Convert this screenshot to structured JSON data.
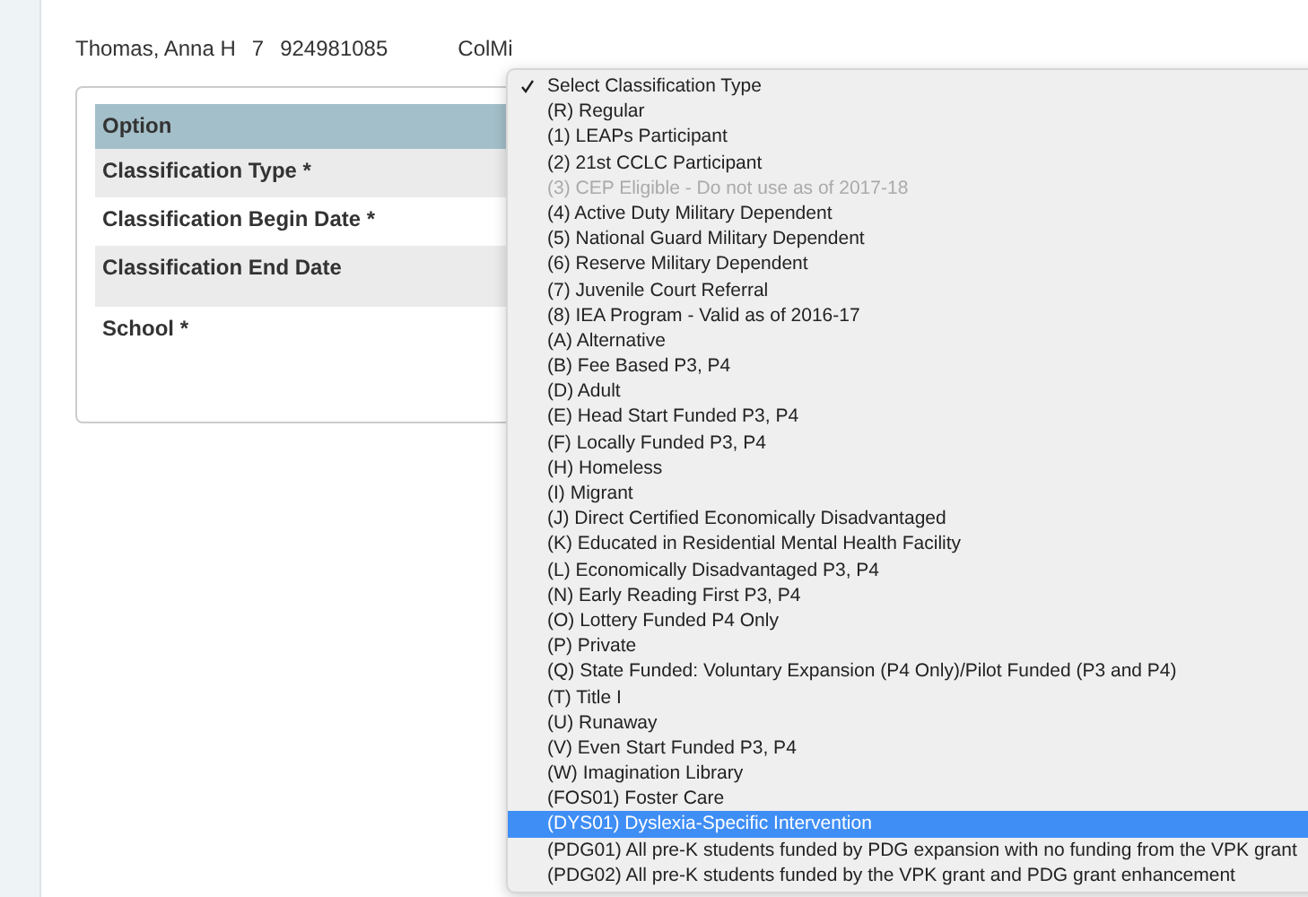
{
  "student_header": {
    "name": "Thomas, Anna H",
    "grade": "7",
    "id": "924981085",
    "school_code": "ColMi"
  },
  "options_table": {
    "header": "Option",
    "rows": [
      {
        "label": "Classification Type *"
      },
      {
        "label": "Classification Begin Date *"
      },
      {
        "label": "Classification End Date"
      },
      {
        "label": "School *"
      }
    ]
  },
  "classification_menu": {
    "items": [
      {
        "label": "Select Classification Type",
        "checked": true,
        "disabled": false,
        "selected": false
      },
      {
        "label": "(R) Regular",
        "checked": false,
        "disabled": false,
        "selected": false
      },
      {
        "label": "(1) LEAPs Participant",
        "checked": false,
        "disabled": false,
        "selected": false
      },
      {
        "label": "(2) 21st CCLC Participant",
        "checked": false,
        "disabled": false,
        "selected": false
      },
      {
        "label": "(3) CEP Eligible - Do not use as of 2017-18",
        "checked": false,
        "disabled": true,
        "selected": false
      },
      {
        "label": "(4) Active Duty Military Dependent",
        "checked": false,
        "disabled": false,
        "selected": false
      },
      {
        "label": "(5) National Guard Military Dependent",
        "checked": false,
        "disabled": false,
        "selected": false
      },
      {
        "label": "(6) Reserve Military Dependent",
        "checked": false,
        "disabled": false,
        "selected": false
      },
      {
        "label": "(7) Juvenile Court Referral",
        "checked": false,
        "disabled": false,
        "selected": false
      },
      {
        "label": "(8) IEA Program - Valid as of 2016-17",
        "checked": false,
        "disabled": false,
        "selected": false
      },
      {
        "label": "(A) Alternative",
        "checked": false,
        "disabled": false,
        "selected": false
      },
      {
        "label": "(B) Fee Based P3, P4",
        "checked": false,
        "disabled": false,
        "selected": false
      },
      {
        "label": "(D) Adult",
        "checked": false,
        "disabled": false,
        "selected": false
      },
      {
        "label": "(E) Head Start Funded P3, P4",
        "checked": false,
        "disabled": false,
        "selected": false
      },
      {
        "label": "(F) Locally Funded P3, P4",
        "checked": false,
        "disabled": false,
        "selected": false
      },
      {
        "label": "(H) Homeless",
        "checked": false,
        "disabled": false,
        "selected": false
      },
      {
        "label": "(I) Migrant",
        "checked": false,
        "disabled": false,
        "selected": false
      },
      {
        "label": "(J) Direct Certified Economically Disadvantaged",
        "checked": false,
        "disabled": false,
        "selected": false
      },
      {
        "label": "(K) Educated in Residential Mental Health Facility",
        "checked": false,
        "disabled": false,
        "selected": false
      },
      {
        "label": "(L) Economically Disadvantaged P3, P4",
        "checked": false,
        "disabled": false,
        "selected": false
      },
      {
        "label": "(N) Early Reading First P3, P4",
        "checked": false,
        "disabled": false,
        "selected": false
      },
      {
        "label": "(O) Lottery Funded P4 Only",
        "checked": false,
        "disabled": false,
        "selected": false
      },
      {
        "label": "(P) Private",
        "checked": false,
        "disabled": false,
        "selected": false
      },
      {
        "label": "(Q) State Funded: Voluntary Expansion (P4 Only)/Pilot Funded (P3 and P4)",
        "checked": false,
        "disabled": false,
        "selected": false
      },
      {
        "label": "(T) Title I",
        "checked": false,
        "disabled": false,
        "selected": false
      },
      {
        "label": "(U) Runaway",
        "checked": false,
        "disabled": false,
        "selected": false
      },
      {
        "label": "(V) Even Start Funded P3, P4",
        "checked": false,
        "disabled": false,
        "selected": false
      },
      {
        "label": "(W) Imagination Library",
        "checked": false,
        "disabled": false,
        "selected": false
      },
      {
        "label": "(FOS01) Foster Care",
        "checked": false,
        "disabled": false,
        "selected": false
      },
      {
        "label": "(DYS01) Dyslexia-Specific Intervention",
        "checked": false,
        "disabled": false,
        "selected": true
      },
      {
        "label": "(PDG01) All pre-K students funded by PDG expansion with no funding from the VPK grant",
        "checked": false,
        "disabled": false,
        "selected": false
      },
      {
        "label": "(PDG02) All pre-K students funded by the VPK grant and PDG grant enhancement",
        "checked": false,
        "disabled": false,
        "selected": false
      }
    ]
  }
}
